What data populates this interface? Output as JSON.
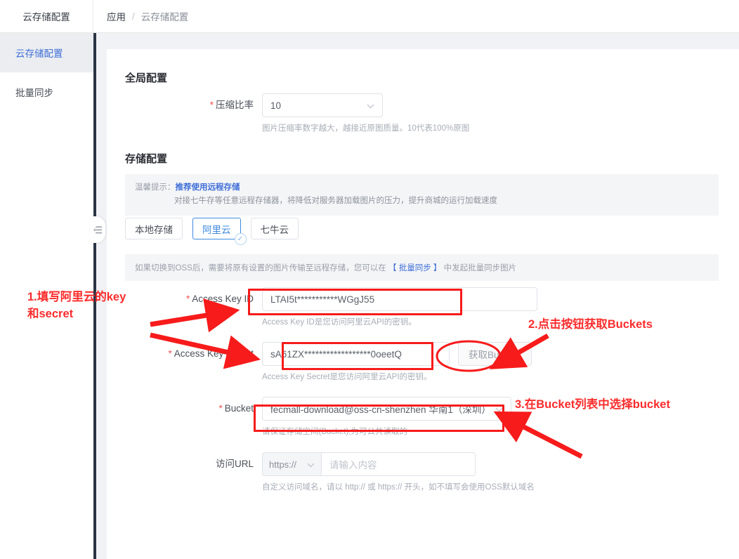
{
  "header": {
    "module_title": "云存储配置",
    "breadcrumb": {
      "parent": "应用",
      "separator": "/",
      "current": "云存储配置"
    }
  },
  "sidebar": {
    "items": [
      {
        "label": "云存储配置",
        "active": true
      },
      {
        "label": "批量同步",
        "active": false
      }
    ],
    "collapse_icon": "collapse-left-icon"
  },
  "global_config": {
    "title": "全局配置",
    "compression": {
      "label": "压缩比率",
      "required": true,
      "value": "10",
      "caret_icon": "chevron-down-icon",
      "helper": "图片压缩率数字越大，越接近原图质量。10代表100%原图"
    }
  },
  "storage_config": {
    "title": "存储配置",
    "tip": {
      "prefix": "温馨提示：",
      "highlight": "推荐使用远程存储",
      "detail": "对接七牛存等任意远程存储器，将降低对服务器加载图片的压力，提升商城的运行加载速度"
    },
    "tabs": [
      {
        "label": "本地存储",
        "selected": false
      },
      {
        "label": "阿里云",
        "selected": true,
        "check_icon": "check-circle-icon"
      },
      {
        "label": "七牛云",
        "selected": false
      }
    ],
    "sync_tip": {
      "before": "如果切换到OSS后，需要将原有设置的图片传输至远程存储，您可以在",
      "link": "【 批量同步 】",
      "after": "中发起批量同步图片"
    },
    "fields": {
      "access_key_id": {
        "label": "Access Key ID",
        "required": true,
        "value": "LTAI5t***********WGgJ55",
        "helper": "Access Key ID是您访问阿里云API的密钥。"
      },
      "access_key_secret": {
        "label": "Access Key Secret",
        "required": true,
        "value": "sA61ZX******************0oeetQ",
        "helper": "Access Key Secret是您访问阿里云API的密钥。",
        "button_label": "获取Buckets"
      },
      "bucket": {
        "label": "Bucket",
        "required": true,
        "value": "fecmall-download@oss-cn-shenzhen 华南1（深圳）",
        "caret_icon": "chevron-down-icon",
        "helper": "请保证存储空间(Bucket),为可公共读取的"
      },
      "access_url": {
        "label": "访问URL",
        "required": false,
        "scheme": "https://",
        "caret_icon": "chevron-down-icon",
        "placeholder": "请输入内容",
        "value": "",
        "helper": "自定义访问域名，请以 http:// 或 https:// 开头，如不填写会使用OSS默认域名"
      }
    }
  },
  "annotations": {
    "color": "#fb2c2c",
    "items": [
      {
        "text": "1.填写阿里云的key\n和secret"
      },
      {
        "text": "2.点击按钮获取Buckets"
      },
      {
        "text": "3.在Bucket列表中选择bucket"
      }
    ]
  }
}
